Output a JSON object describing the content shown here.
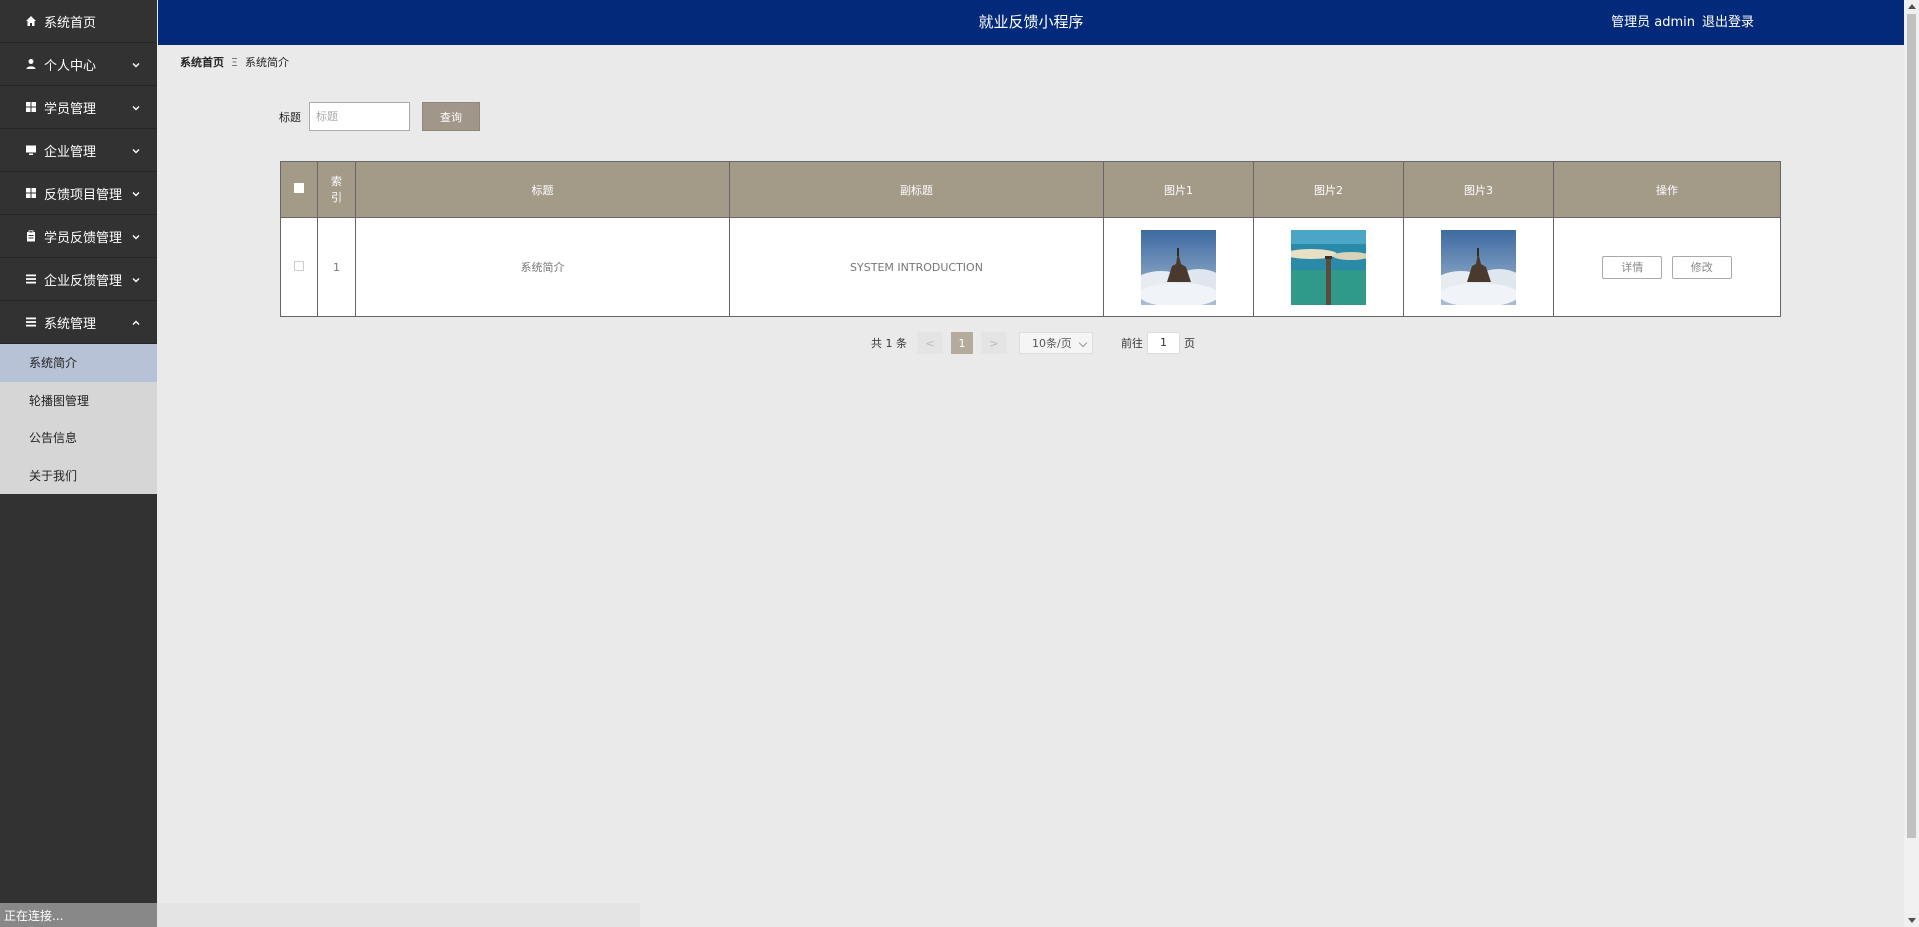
{
  "header": {
    "title": "就业反馈小程序",
    "user": "管理员 admin",
    "logout": "退出登录"
  },
  "sidebar": {
    "items": [
      {
        "label": "系统首页",
        "icon": "home-icon"
      },
      {
        "label": "个人中心",
        "icon": "user-icon"
      },
      {
        "label": "学员管理",
        "icon": "grid-icon"
      },
      {
        "label": "企业管理",
        "icon": "monitor-icon"
      },
      {
        "label": "反馈项目管理",
        "icon": "grid-icon"
      },
      {
        "label": "学员反馈管理",
        "icon": "clipboard-icon"
      },
      {
        "label": "企业反馈管理",
        "icon": "list-icon"
      },
      {
        "label": "系统管理",
        "icon": "list-icon"
      }
    ],
    "sub_items": [
      "系统简介",
      "轮播图管理",
      "公告信息",
      "关于我们"
    ]
  },
  "status": {
    "text": "正在连接..."
  },
  "breadcrumb": {
    "home": "系统首页",
    "sep": "Ξ",
    "current": "系统简介"
  },
  "search": {
    "label": "标题",
    "placeholder": "标题",
    "button": "查询"
  },
  "table": {
    "headers": [
      "索引",
      "标题",
      "副标题",
      "图片1",
      "图片2",
      "图片3",
      "操作"
    ],
    "rows": [
      {
        "index": "1",
        "title": "系统简介",
        "subtitle": "SYSTEM INTRODUCTION",
        "actions": [
          "详情",
          "修改"
        ]
      }
    ]
  },
  "pagination": {
    "total": "共 1 条",
    "prev": "<",
    "current": "1",
    "next": ">",
    "page_size": "10条/页",
    "goto_label": "前往",
    "goto_value": "1",
    "goto_suffix": "页"
  },
  "colors": {
    "topbar": "#032a7a",
    "sidebar": "#323232",
    "table_header": "#a39a88",
    "accent_button": "#a0968a"
  }
}
